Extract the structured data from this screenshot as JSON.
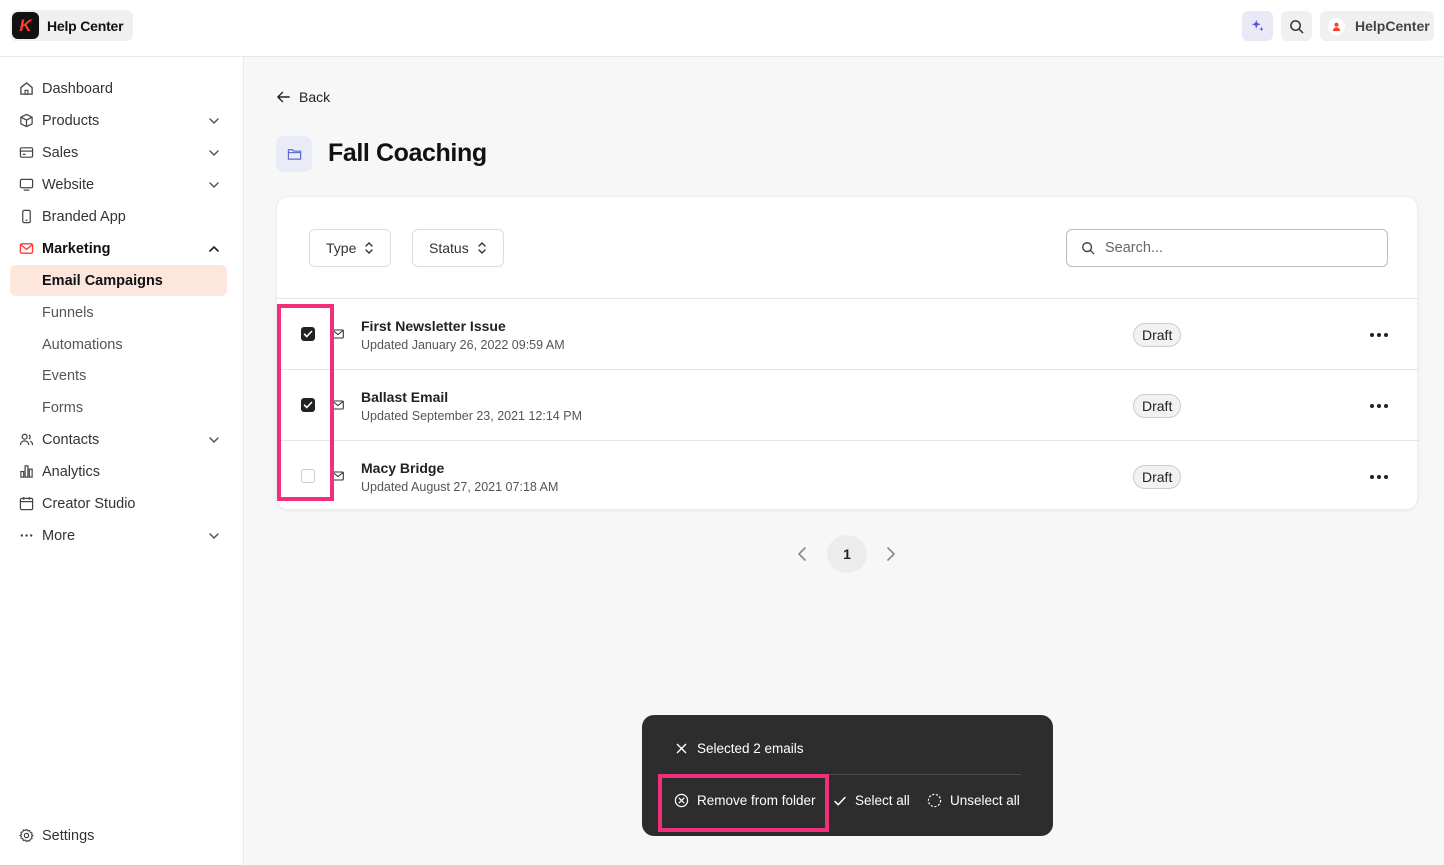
{
  "app": {
    "brand_name": "Help Center",
    "brand_logo_letter": "K",
    "account_name": "HelpCenter",
    "accent_color": "#ff3b30"
  },
  "topbar": {
    "icons": [
      "sparkle-icon",
      "search-icon",
      "user-icon"
    ]
  },
  "sidebar": {
    "items": [
      {
        "label": "Dashboard",
        "icon": "home-icon"
      },
      {
        "label": "Products",
        "icon": "box-icon",
        "expandable": true
      },
      {
        "label": "Sales",
        "icon": "card-icon",
        "expandable": true
      },
      {
        "label": "Website",
        "icon": "monitor-icon",
        "expandable": true
      },
      {
        "label": "Branded App",
        "icon": "phone-icon"
      },
      {
        "label": "Marketing",
        "icon": "mail-icon",
        "expandable": true,
        "expanded": true
      },
      {
        "label": "Contacts",
        "icon": "users-icon",
        "expandable": true
      },
      {
        "label": "Analytics",
        "icon": "chart-icon"
      },
      {
        "label": "Creator Studio",
        "icon": "calendar-icon"
      },
      {
        "label": "More",
        "icon": "dots-icon",
        "expandable": true
      }
    ],
    "marketing_subitems": [
      {
        "label": "Email Campaigns",
        "selected": true
      },
      {
        "label": "Funnels"
      },
      {
        "label": "Automations"
      },
      {
        "label": "Events"
      },
      {
        "label": "Forms"
      }
    ],
    "settings_label": "Settings"
  },
  "main": {
    "back_label": "Back",
    "title": "Fall Coaching",
    "filters": {
      "type_label": "Type",
      "status_label": "Status"
    },
    "search": {
      "placeholder": "Search..."
    },
    "emails": [
      {
        "title": "First Newsletter Issue",
        "updated": "Updated January 26, 2022 09:59 AM",
        "status": "Draft",
        "checked": true
      },
      {
        "title": "Ballast Email",
        "updated": "Updated September 23, 2021 12:14 PM",
        "status": "Draft",
        "checked": true
      },
      {
        "title": "Macy Bridge",
        "updated": "Updated August 27, 2021 07:18 AM",
        "status": "Draft",
        "checked": false
      }
    ],
    "pagination": {
      "current_page": "1"
    }
  },
  "selection_bar": {
    "selected_text": "Selected 2 emails",
    "remove_label": "Remove from folder",
    "select_all_label": "Select all",
    "unselect_all_label": "Unselect all",
    "highlight_color": "#f0307a"
  }
}
